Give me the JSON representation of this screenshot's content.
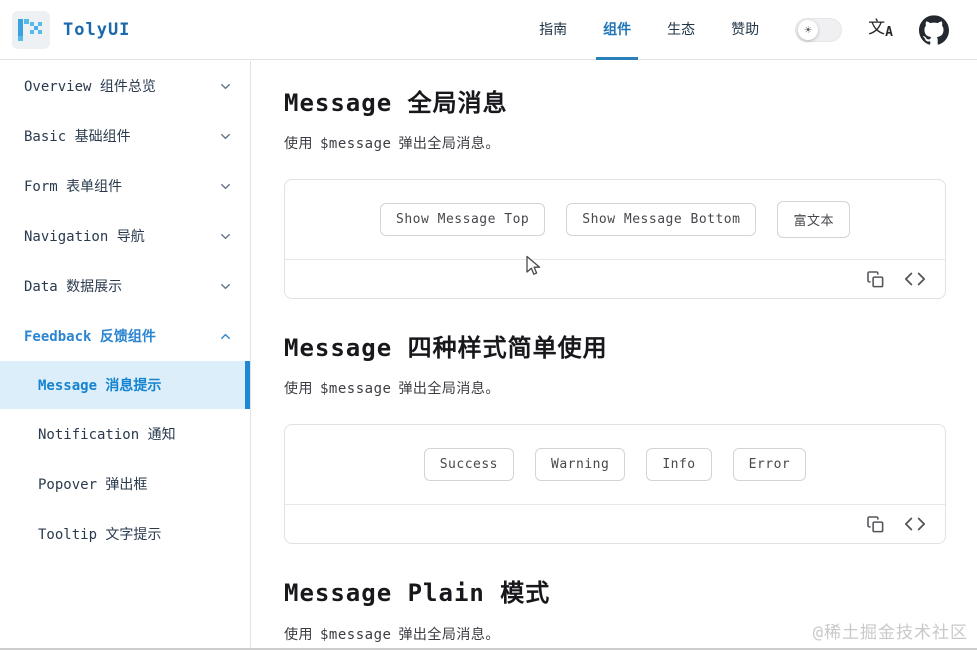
{
  "header": {
    "logo_text": "TolyUI",
    "nav_items": [
      {
        "label": "指南",
        "active": false
      },
      {
        "label": "组件",
        "active": true
      },
      {
        "label": "生态",
        "active": false
      },
      {
        "label": "赞助",
        "active": false
      }
    ],
    "theme_sun_glyph": "☀",
    "translate_icon_cjk": "文",
    "translate_icon_latin": "A"
  },
  "sidebar": {
    "groups": [
      {
        "label": "Overview 组件总览",
        "expanded": false
      },
      {
        "label": "Basic 基础组件",
        "expanded": false
      },
      {
        "label": "Form 表单组件",
        "expanded": false
      },
      {
        "label": "Navigation 导航",
        "expanded": false
      },
      {
        "label": "Data 数据展示",
        "expanded": false
      },
      {
        "label": "Feedback 反馈组件",
        "expanded": true
      }
    ],
    "feedback_children": [
      {
        "label": "Message 消息提示",
        "active": true
      },
      {
        "label": "Notification 通知",
        "active": false
      },
      {
        "label": "Popover 弹出框",
        "active": false
      },
      {
        "label": "Tooltip 文字提示",
        "active": false
      }
    ]
  },
  "main": {
    "sections": [
      {
        "title": "Message 全局消息",
        "desc_prefix": "使用",
        "desc_code": "$message",
        "desc_suffix": "弹出全局消息。",
        "buttons": [
          "Show Message Top",
          "Show Message Bottom",
          "富文本"
        ]
      },
      {
        "title": "Message 四种样式简单使用",
        "desc_prefix": "使用",
        "desc_code": "$message",
        "desc_suffix": "弹出全局消息。",
        "buttons": [
          "Success",
          "Warning",
          "Info",
          "Error"
        ]
      },
      {
        "title": "Message Plain 模式",
        "desc_prefix": "使用",
        "desc_code": "$message",
        "desc_suffix": "弹出全局消息。",
        "buttons": []
      }
    ]
  },
  "watermark": "@稀土掘金技术社区",
  "colors": {
    "accent": "#2080c9",
    "brand_text": "#1a68ad",
    "active_item_bg": "#dceef9",
    "active_item_bar": "#1e88d2",
    "border": "#e2e2e3"
  }
}
